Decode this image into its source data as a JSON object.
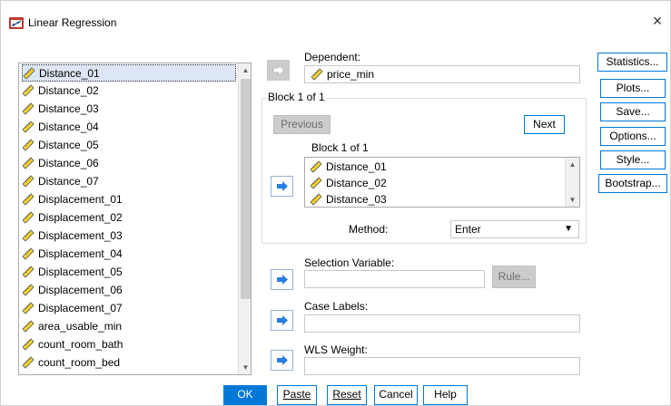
{
  "window": {
    "title": "Linear Regression",
    "close_glyph": "×"
  },
  "variables": [
    "Distance_01",
    "Distance_02",
    "Distance_03",
    "Distance_04",
    "Distance_05",
    "Distance_06",
    "Distance_07",
    "Displacement_01",
    "Displacement_02",
    "Displacement_03",
    "Displacement_04",
    "Displacement_05",
    "Displacement_06",
    "Displacement_07",
    "area_usable_min",
    "count_room_bath",
    "count_room_bed"
  ],
  "selected_variable_index": 0,
  "dependent": {
    "label": "Dependent:",
    "value": "price_min"
  },
  "block": {
    "group_title": "Block 1 of 1",
    "previous_label": "Previous",
    "next_label": "Next",
    "inner_title": "Block 1 of 1",
    "independents": [
      "Distance_01",
      "Distance_02",
      "Distance_03"
    ],
    "method_label": "Method:",
    "method_value": "Enter"
  },
  "selection_variable": {
    "label": "Selection Variable:",
    "value": "",
    "rule_label": "Rule..."
  },
  "case_labels": {
    "label": "Case Labels:",
    "value": ""
  },
  "wls_weight": {
    "label": "WLS Weight:",
    "value": ""
  },
  "side_buttons": [
    "Statistics...",
    "Plots...",
    "Save...",
    "Options...",
    "Style...",
    "Bootstrap..."
  ],
  "bottom_buttons": {
    "ok": "OK",
    "paste": "Paste",
    "reset": "Reset",
    "cancel": "Cancel",
    "help": "Help"
  },
  "colors": {
    "accent": "#0078d7",
    "selected_bg": "#dce6f4",
    "disabled": "#cccccc"
  },
  "icons": {
    "variable": "scale-ruler-icon",
    "move": "arrow-right-icon"
  }
}
